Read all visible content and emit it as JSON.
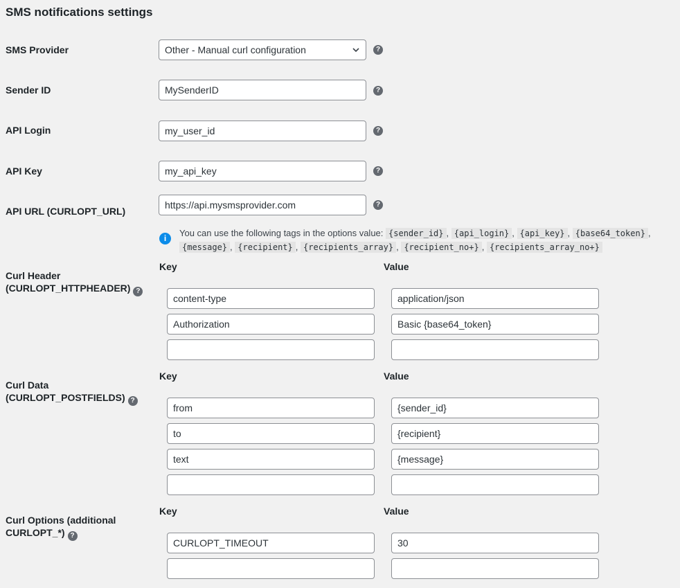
{
  "title": "SMS notifications settings",
  "provider": {
    "label": "SMS Provider",
    "selected": "Other - Manual curl configuration"
  },
  "sender": {
    "label": "Sender ID",
    "value": "MySenderID"
  },
  "login": {
    "label": "API Login",
    "value": "my_user_id"
  },
  "key": {
    "label": "API Key",
    "value": "my_api_key"
  },
  "url": {
    "label": "API URL (CURLOPT_URL)",
    "value": "https://api.mysmsprovider.com"
  },
  "help_glyph": "?",
  "info": {
    "icon": "i",
    "text": "You can use the following tags in the options value:",
    "tags": [
      "{sender_id}",
      "{api_login}",
      "{api_key}",
      "{base64_token}",
      "{message}",
      "{recipient}",
      "{recipients_array}",
      "{recipient_no+}",
      "{recipients_array_no+}"
    ],
    "sep": ","
  },
  "columns": {
    "key": "Key",
    "value": "Value"
  },
  "header": {
    "label_line1": "Curl Header",
    "label_line2": "(CURLOPT_HTTPHEADER)",
    "rows": [
      {
        "key": "content-type",
        "value": "application/json"
      },
      {
        "key": "Authorization",
        "value": "Basic {base64_token}"
      },
      {
        "key": "",
        "value": ""
      }
    ]
  },
  "data": {
    "label_line1": "Curl Data",
    "label_line2": "(CURLOPT_POSTFIELDS)",
    "rows": [
      {
        "key": "from",
        "value": "{sender_id}"
      },
      {
        "key": "to",
        "value": "{recipient}"
      },
      {
        "key": "text",
        "value": "{message}"
      },
      {
        "key": "",
        "value": ""
      }
    ]
  },
  "options": {
    "label_line1": "Curl Options (additional",
    "label_line2": "CURLOPT_*)",
    "rows": [
      {
        "key": "CURLOPT_TIMEOUT",
        "value": "30"
      },
      {
        "key": "",
        "value": ""
      }
    ]
  }
}
